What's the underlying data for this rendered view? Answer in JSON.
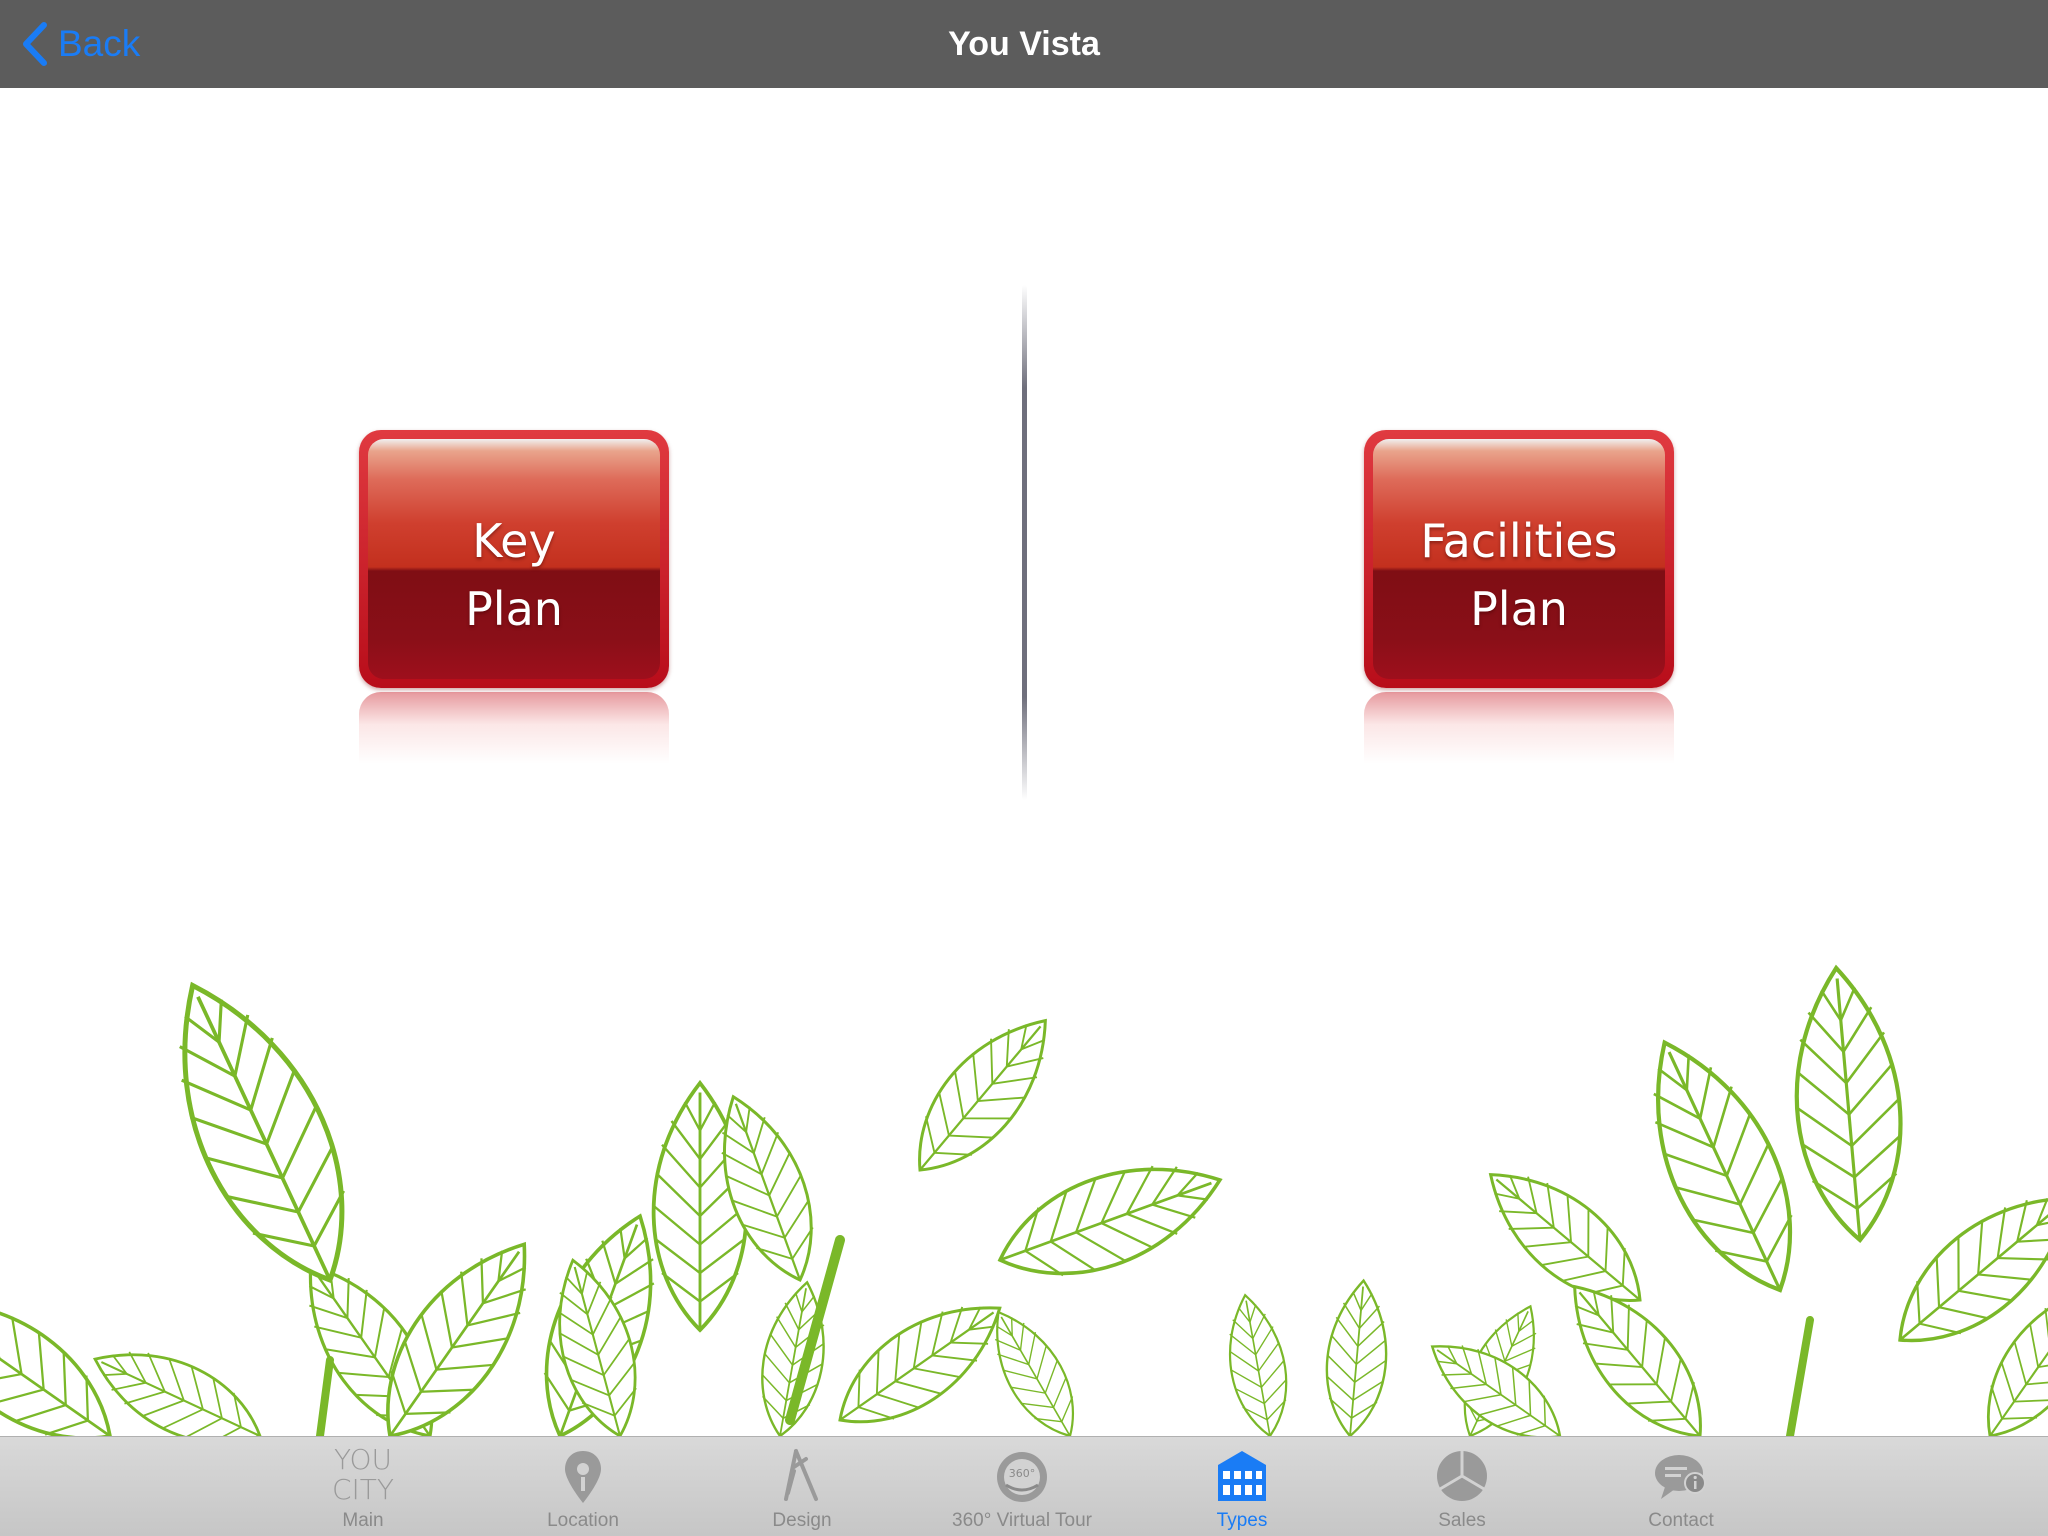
{
  "nav": {
    "back_label": "Back",
    "title": "You Vista"
  },
  "buttons": {
    "key_plan": "Key\nPlan",
    "facilities_plan": "Facilities\nPlan"
  },
  "tabs": [
    {
      "label": "Main",
      "icon": "you-city-logo-icon",
      "logo_text": "YOU\nCITY"
    },
    {
      "label": "Location",
      "icon": "location-pin-icon"
    },
    {
      "label": "Design",
      "icon": "compass-drawing-icon"
    },
    {
      "label": "360° Virtual Tour",
      "icon": "virtual-tour-icon"
    },
    {
      "label": "Types",
      "icon": "building-icon",
      "active": true
    },
    {
      "label": "Sales",
      "icon": "pie-chart-icon"
    },
    {
      "label": "Contact",
      "icon": "chat-info-icon"
    }
  ],
  "colors": {
    "navbar": "#5c5c5c",
    "accent": "#1a7cf5",
    "button_red": "#b80d1a",
    "leaf_green": "#7ab829"
  }
}
